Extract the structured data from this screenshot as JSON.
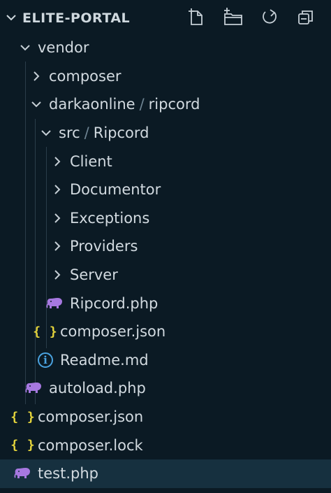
{
  "explorer": {
    "title": "ELITE-PORTAL",
    "actions": [
      {
        "name": "new-file-icon"
      },
      {
        "name": "new-folder-icon"
      },
      {
        "name": "refresh-icon"
      },
      {
        "name": "collapse-all-icon"
      }
    ]
  },
  "tree": {
    "vendor": "vendor",
    "composer": "composer",
    "darkaonline": "darkaonline",
    "path_sep": "/",
    "ripcord": "ripcord",
    "src": "src",
    "src_ripcord": "Ripcord",
    "client": "Client",
    "documentor": "Documentor",
    "exceptions": "Exceptions",
    "providers": "Providers",
    "server": "Server",
    "ripcord_php": "Ripcord.php",
    "vendor_composer_json": "composer.json",
    "readme": "Readme.md",
    "autoload": "autoload.php",
    "root_composer_json": "composer.json",
    "composer_lock": "composer.lock",
    "test_php": "test.php"
  },
  "icons": {
    "json_glyph": "{ }",
    "info_glyph": "i"
  },
  "colors": {
    "background": "#0b1a24",
    "selected_row": "#16303f",
    "php_icon": "#a678e0",
    "json_icon": "#e6d53c",
    "info_icon": "#4aa3e0"
  }
}
